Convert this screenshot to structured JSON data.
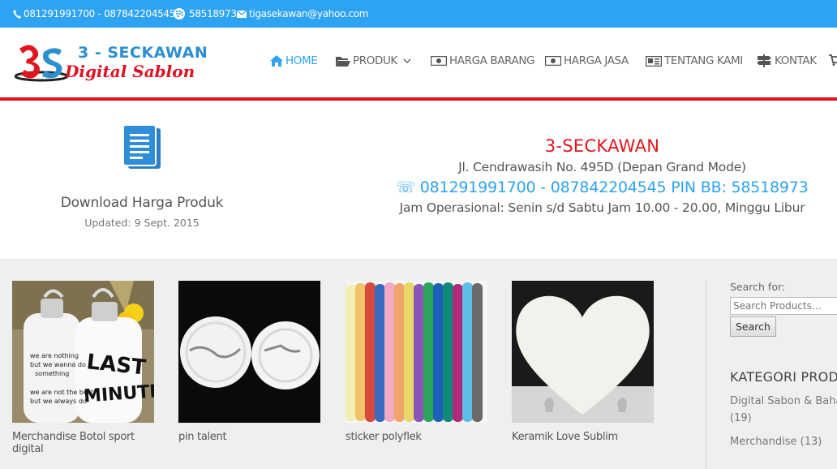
{
  "topbar": {
    "phone": "081291991700 - 087842204545",
    "bb_pin": "58518973",
    "email": "tigasekawan@yahoo.com"
  },
  "logo": {
    "line1": "3 - SECKAWAN",
    "line2": "Digital Sablon"
  },
  "nav": [
    {
      "label": "HOME",
      "icon": "home-icon",
      "active": true
    },
    {
      "label": "PRODUK",
      "icon": "folder-icon",
      "dropdown": true
    },
    {
      "label": "HARGA BARANG",
      "icon": "money-icon"
    },
    {
      "label": "HARGA JASA",
      "icon": "money-icon"
    },
    {
      "label": "TENTANG KAMI",
      "icon": "newspaper-icon"
    },
    {
      "label": "KONTAK",
      "icon": "signpost-icon"
    }
  ],
  "download": {
    "title": "Download Harga Produk",
    "updated": "Updated: 9 Sept. 2015"
  },
  "contact": {
    "title": "3-SECKAWAN",
    "address": "Jl. Cendrawasih No. 495D (Depan Grand Mode)",
    "phone": "☏ 081291991700 - 087842204545 PIN BB: 58518973",
    "hours": "Jam Operasional: Senin s/d Sabtu Jam 10.00 - 20.00, Minggu Libur"
  },
  "products": [
    {
      "name": "Merchandise Botol sport digital"
    },
    {
      "name": "pin talent"
    },
    {
      "name": "sticker polyflek"
    },
    {
      "name": "Keramik Love Sublim"
    }
  ],
  "bottle_prints": {
    "left": "we are nothing but we wanna do something we are not the best but we always do",
    "right": "LAST MINUTE"
  },
  "sidebar": {
    "search_label": "Search for:",
    "search_placeholder": "Search Products…",
    "search_button": "Search",
    "category_heading": "KATEGORI PRODUK",
    "categories": [
      {
        "name": "Digital Sabon & Bahan",
        "count": "(19)"
      },
      {
        "name": "Merchandise",
        "count": "(13)"
      }
    ]
  },
  "colors": {
    "accent": "#2ea3f2",
    "brand_red": "#e0161e"
  }
}
